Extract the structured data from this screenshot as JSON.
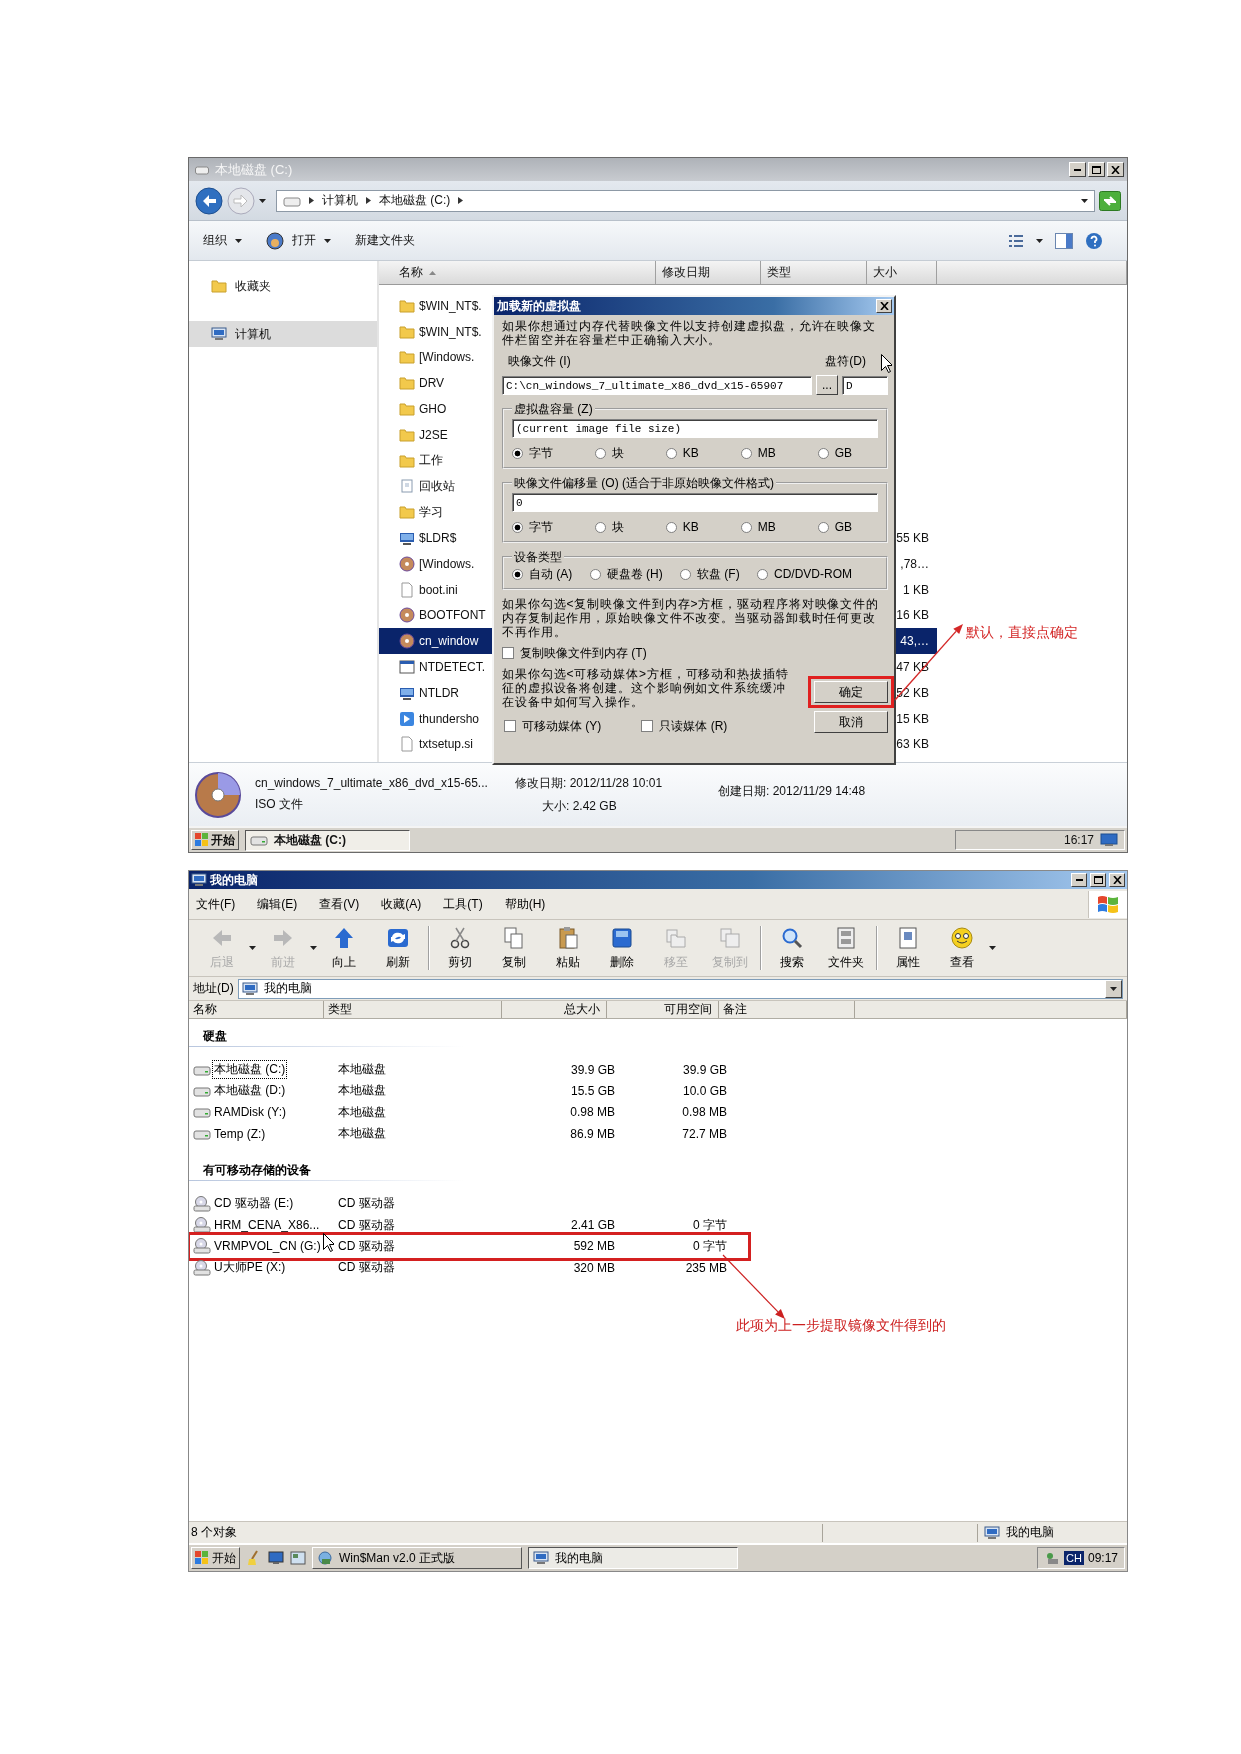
{
  "explorer_window": {
    "title": "本地磁盘 (C:)",
    "breadcrumb": [
      "计算机",
      "本地磁盘 (C:)"
    ],
    "toolbar": [
      {
        "label": "组织",
        "dropdown": true,
        "kind": "plain"
      },
      {
        "label": "打开",
        "dropdown": true,
        "kind": "open"
      },
      {
        "label": "新建文件夹",
        "dropdown": false,
        "kind": "plain"
      }
    ],
    "nav": [
      {
        "label": "收藏夹",
        "kind": "favorites",
        "selected": false
      },
      {
        "label": "计算机",
        "kind": "computer",
        "selected": true
      }
    ],
    "columns": [
      {
        "label": "名称",
        "sorted": true
      },
      {
        "label": "修改日期",
        "sorted": false
      },
      {
        "label": "类型",
        "sorted": false
      },
      {
        "label": "大小",
        "sorted": false
      }
    ],
    "files": [
      {
        "name": "$WIN_NT$.",
        "kind": "folder",
        "selected": false
      },
      {
        "name": "$WIN_NT$.",
        "kind": "folder",
        "selected": false
      },
      {
        "name": "[Windows.",
        "kind": "folder",
        "selected": false
      },
      {
        "name": "DRV",
        "kind": "folder",
        "selected": false
      },
      {
        "name": "GHO",
        "kind": "folder",
        "selected": false
      },
      {
        "name": "J2SE",
        "kind": "folder",
        "selected": false
      },
      {
        "name": "工作",
        "kind": "folder",
        "selected": false
      },
      {
        "name": "回收站",
        "kind": "recycle",
        "selected": false
      },
      {
        "name": "学习",
        "kind": "folder",
        "selected": false
      },
      {
        "name": "$LDR$",
        "kind": "system",
        "size": "55 KB",
        "selected": false
      },
      {
        "name": "[Windows.",
        "kind": "disc",
        "size": ",78…",
        "selected": false
      },
      {
        "name": "boot.ini",
        "kind": "file",
        "size": "1 KB",
        "selected": false
      },
      {
        "name": "BOOTFONT",
        "kind": "disc",
        "size": "16 KB",
        "selected": false
      },
      {
        "name": "cn_window",
        "kind": "disc",
        "size": "43,…",
        "selected": true
      },
      {
        "name": "NTDETECT.",
        "kind": "settings",
        "size": "47 KB",
        "selected": false
      },
      {
        "name": "NTLDR",
        "kind": "system",
        "size": "52 KB",
        "selected": false
      },
      {
        "name": "thundersho",
        "kind": "thunder",
        "size": "15 KB",
        "selected": false
      },
      {
        "name": "txtsetup.si",
        "kind": "file",
        "size": "63 KB",
        "selected": false
      }
    ],
    "details": {
      "name": "cn_windows_7_ultimate_x86_dvd_x15-65...",
      "type": "ISO 文件",
      "modified": "修改日期: 2012/11/28 10:01",
      "size": "大小: 2.42 GB",
      "created": "创建日期: 2012/11/29 14:48"
    },
    "taskbar": {
      "start": "开始",
      "tasks": [
        {
          "label": "本地磁盘 (C:)",
          "active": true
        }
      ],
      "clock": "16:17"
    },
    "annotation": "默认，直接点确定"
  },
  "mount_dialog": {
    "title": "加载新的虚拟盘",
    "intro": "如果你想通过内存代替映像文件以支持创建虚拟盘，允许在映像文件栏留空并在容量栏中正确输入大小。",
    "image_label": "映像文件 (I)",
    "drive_label": "盘符(D)",
    "image_value": "C:\\cn_windows_7_ultimate_x86_dvd_x15-65907",
    "browse": "...",
    "drive_value": "D",
    "groups": [
      {
        "title": "虚拟盘容量 (Z)",
        "value": "(current image file size)",
        "options": [
          {
            "label": "字节",
            "selected": true
          },
          {
            "label": "块",
            "selected": false
          },
          {
            "label": "KB",
            "selected": false
          },
          {
            "label": "MB",
            "selected": false
          },
          {
            "label": "GB",
            "selected": false
          }
        ]
      },
      {
        "title": "映像文件偏移量 (O)  (适合于非原始映像文件格式)",
        "value": "0",
        "options": [
          {
            "label": "字节",
            "selected": true
          },
          {
            "label": "块",
            "selected": false
          },
          {
            "label": "KB",
            "selected": false
          },
          {
            "label": "MB",
            "selected": false
          },
          {
            "label": "GB",
            "selected": false
          }
        ]
      },
      {
        "title": "设备类型",
        "options": [
          {
            "label": "自动 (A)",
            "selected": true
          },
          {
            "label": "硬盘卷 (H)",
            "selected": false
          },
          {
            "label": "软盘 (F)",
            "selected": false
          },
          {
            "label": "CD/DVD-ROM",
            "selected": false
          }
        ]
      }
    ],
    "copy_note": "如果你勾选<复制映像文件到内存>方框，驱动程序将对映像文件的内存复制起作用，原始映像文件不改变。当驱动器卸载时任何更改不再作用。",
    "copy_checkbox": {
      "label": "复制映像文件到内存 (T)",
      "checked": false
    },
    "removable_note": "如果你勾选<可移动媒体>方框，可移动和热拔插特征的虚拟设备将创建。这个影响例如文件系统缓冲在设备中如何写入操作。",
    "checkboxes": [
      {
        "label": "可移动媒体 (Y)",
        "checked": false
      },
      {
        "label": "只读媒体 (R)",
        "checked": false
      }
    ],
    "buttons": [
      {
        "label": "确定",
        "highlighted": true
      },
      {
        "label": "取消",
        "highlighted": false
      }
    ]
  },
  "mycomputer_window": {
    "title": "我的电脑",
    "menu": [
      "文件(F)",
      "编辑(E)",
      "查看(V)",
      "收藏(A)",
      "工具(T)",
      "帮助(H)"
    ],
    "toolbar_groups": [
      {
        "buttons": [
          {
            "label": "后退",
            "kind": "back",
            "disabled": true,
            "dropdown": true
          },
          {
            "label": "前进",
            "kind": "forward",
            "disabled": true,
            "dropdown": true
          },
          {
            "label": "向上",
            "kind": "up",
            "disabled": false,
            "dropdown": false
          },
          {
            "label": "刷新",
            "kind": "refresh",
            "disabled": false,
            "dropdown": false
          }
        ]
      },
      {
        "buttons": [
          {
            "label": "剪切",
            "kind": "cut",
            "disabled": false,
            "dropdown": false
          },
          {
            "label": "复制",
            "kind": "copy",
            "disabled": false,
            "dropdown": false
          },
          {
            "label": "粘贴",
            "kind": "paste",
            "disabled": false,
            "dropdown": false
          },
          {
            "label": "删除",
            "kind": "delete",
            "disabled": false,
            "dropdown": false
          },
          {
            "label": "移至",
            "kind": "move",
            "disabled": true,
            "dropdown": false
          },
          {
            "label": "复制到",
            "kind": "copyto",
            "disabled": true,
            "dropdown": false
          }
        ]
      },
      {
        "buttons": [
          {
            "label": "搜索",
            "kind": "search",
            "disabled": false,
            "dropdown": false
          },
          {
            "label": "文件夹",
            "kind": "folders",
            "disabled": false,
            "dropdown": false
          }
        ]
      },
      {
        "buttons": [
          {
            "label": "属性",
            "kind": "properties",
            "disabled": false,
            "dropdown": false
          },
          {
            "label": "查看",
            "kind": "views",
            "disabled": false,
            "dropdown": true
          }
        ]
      }
    ],
    "address": {
      "label": "地址(D)",
      "value": "我的电脑"
    },
    "columns": [
      "名称",
      "类型",
      "总大小",
      "可用空间",
      "备注"
    ],
    "groups": [
      {
        "title": "硬盘",
        "drives": [
          {
            "name": "本地磁盘 (C:)",
            "type": "本地磁盘",
            "total": "39.9 GB",
            "free": "39.9 GB",
            "kind": "hdd",
            "focused": true,
            "highlighted": false
          },
          {
            "name": "本地磁盘 (D:)",
            "type": "本地磁盘",
            "total": "15.5 GB",
            "free": "10.0 GB",
            "kind": "hdd",
            "focused": false,
            "highlighted": false
          },
          {
            "name": "RAMDisk (Y:)",
            "type": "本地磁盘",
            "total": "0.98 MB",
            "free": "0.98 MB",
            "kind": "hdd",
            "focused": false,
            "highlighted": false
          },
          {
            "name": "Temp (Z:)",
            "type": "本地磁盘",
            "total": "86.9 MB",
            "free": "72.7 MB",
            "kind": "hdd",
            "focused": false,
            "highlighted": false
          }
        ]
      },
      {
        "title": "有可移动存储的设备",
        "drives": [
          {
            "name": "CD 驱动器 (E:)",
            "type": "CD 驱动器",
            "kind": "cd",
            "focused": false,
            "highlighted": false
          },
          {
            "name": "HRM_CENA_X86...",
            "type": "CD 驱动器",
            "total": "2.41 GB",
            "free": "0 字节",
            "kind": "cd",
            "focused": false,
            "highlighted": false
          },
          {
            "name": "VRMPVOL_CN (G:)",
            "type": "CD 驱动器",
            "total": "592 MB",
            "free": "0 字节",
            "kind": "cd",
            "focused": false,
            "highlighted": true
          },
          {
            "name": "U大师PE (X:)",
            "type": "CD 驱动器",
            "total": "320 MB",
            "free": "235 MB",
            "kind": "cd",
            "focused": false,
            "highlighted": false
          }
        ]
      }
    ],
    "status": {
      "count": "8 个对象",
      "location": "我的电脑"
    },
    "taskbar": {
      "start": "开始",
      "tasks": [
        {
          "label": "Win$Man v2.0 正式版",
          "active": false
        },
        {
          "label": "我的电脑",
          "active": true
        }
      ],
      "input_method": "CH",
      "clock": "09:17"
    },
    "annotation": "此项为上一步提取镜像文件得到的"
  }
}
